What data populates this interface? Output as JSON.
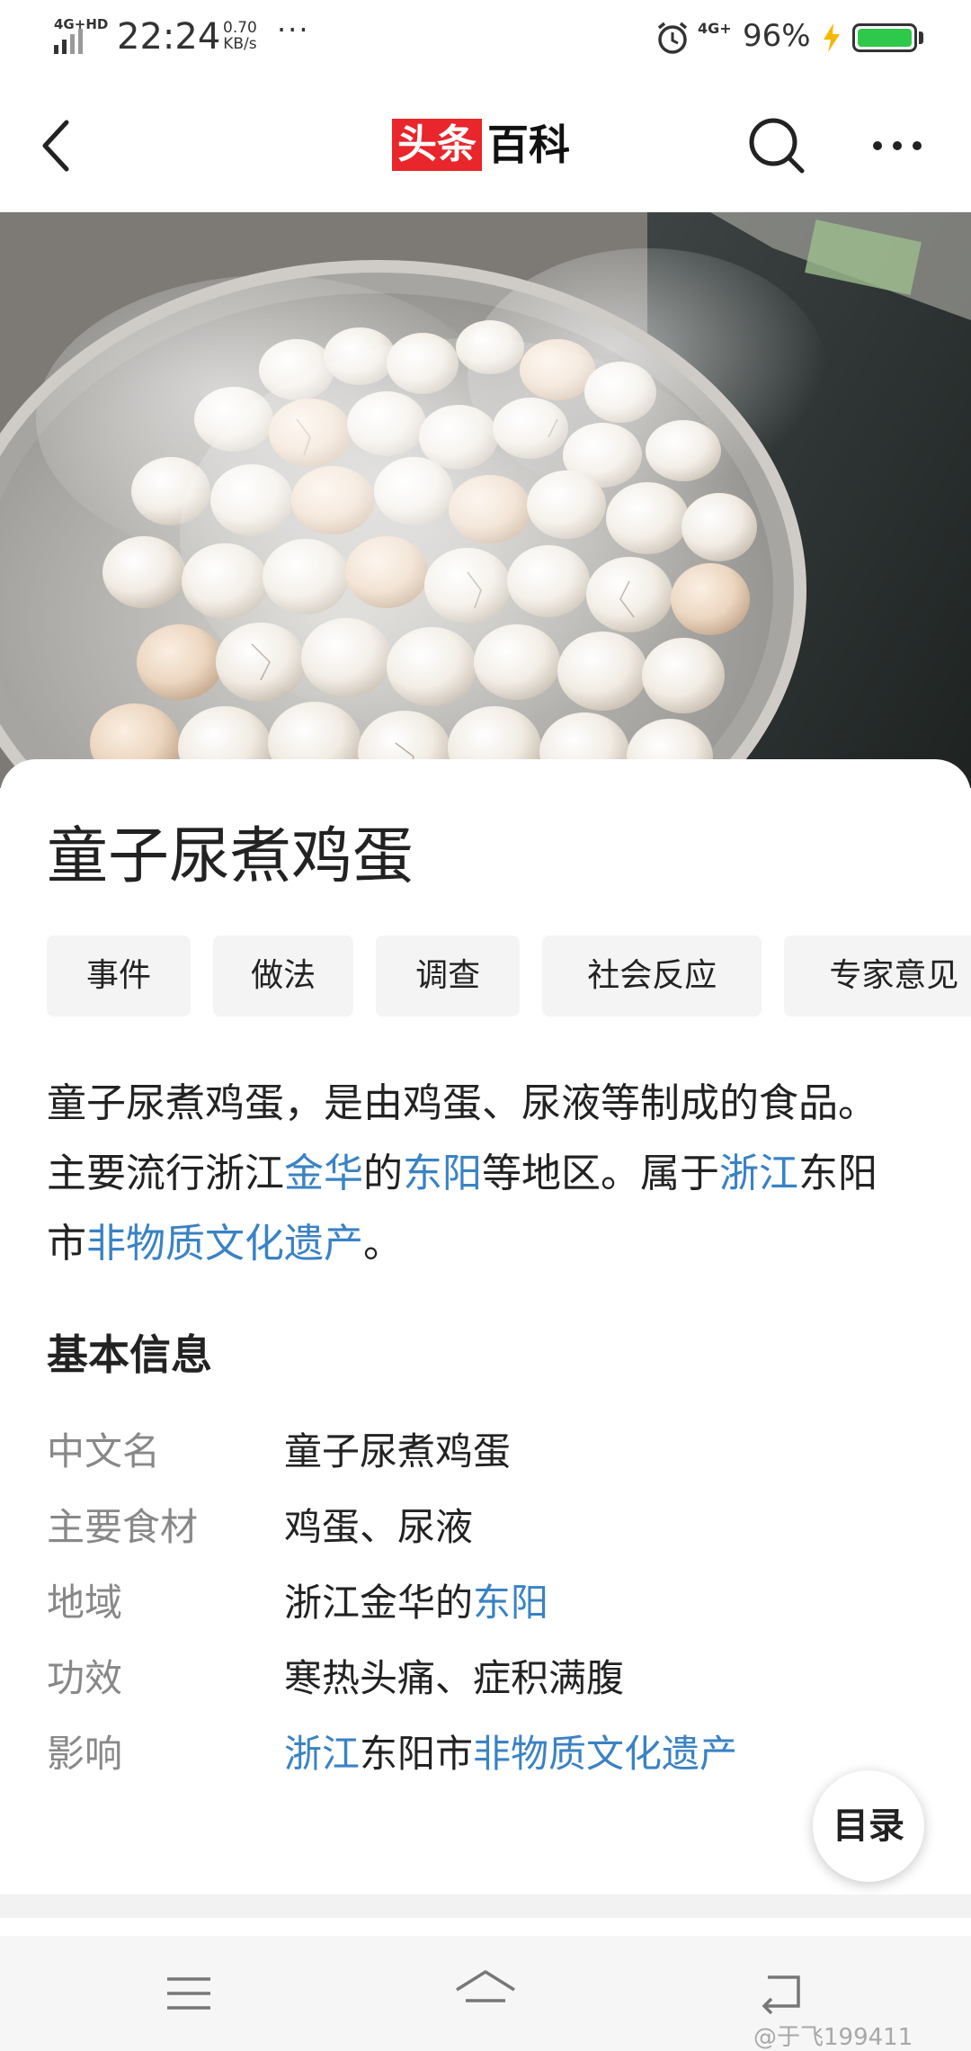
{
  "status_bar": {
    "network": "4G+HD",
    "time": "22:24",
    "speed_value": "0.70",
    "speed_unit": "KB/s",
    "more": "···",
    "network_right": "4G+",
    "battery": "96%"
  },
  "header": {
    "logo_red": "头条",
    "logo_black": "百科",
    "back_icon": "chevron-left-icon",
    "search_icon": "search-icon",
    "more_icon": "more-icon"
  },
  "article": {
    "title": "童子尿煮鸡蛋",
    "tabs": [
      {
        "label": "事件"
      },
      {
        "label": "做法"
      },
      {
        "label": "调查"
      },
      {
        "label": "社会反应"
      },
      {
        "label": "专家意见"
      }
    ],
    "summary": [
      {
        "text": "童子尿煮鸡蛋，是由鸡蛋、尿液等制成的食品。主要流行浙江",
        "link": false
      },
      {
        "text": "金华",
        "link": true
      },
      {
        "text": "的",
        "link": false
      },
      {
        "text": "东阳",
        "link": true
      },
      {
        "text": "等地区。属于",
        "link": false
      },
      {
        "text": "浙江",
        "link": true
      },
      {
        "text": "东阳市",
        "link": false
      },
      {
        "text": "非物质文化遗产",
        "link": true
      },
      {
        "text": "。",
        "link": false
      }
    ],
    "section_title": "基本信息",
    "info": [
      {
        "key": "中文名",
        "parts": [
          {
            "text": "童子尿煮鸡蛋",
            "link": false
          }
        ]
      },
      {
        "key": "主要食材",
        "parts": [
          {
            "text": "鸡蛋、尿液",
            "link": false
          }
        ]
      },
      {
        "key": "地域",
        "parts": [
          {
            "text": "浙江金华的",
            "link": false
          },
          {
            "text": "东阳",
            "link": true
          }
        ]
      },
      {
        "key": "功效",
        "parts": [
          {
            "text": "寒热头痛、症积满腹",
            "link": false
          }
        ]
      },
      {
        "key": "影响",
        "parts": [
          {
            "text": "浙江",
            "link": true
          },
          {
            "text": "东阳市",
            "link": false
          },
          {
            "text": "非物质文化遗产",
            "link": true
          }
        ]
      }
    ],
    "toc_label": "目录"
  },
  "nav": {
    "watermark": "@于飞199411"
  },
  "colors": {
    "link": "#3a82c4",
    "logo_red": "#e8262b",
    "battery": "#2ec84a"
  }
}
